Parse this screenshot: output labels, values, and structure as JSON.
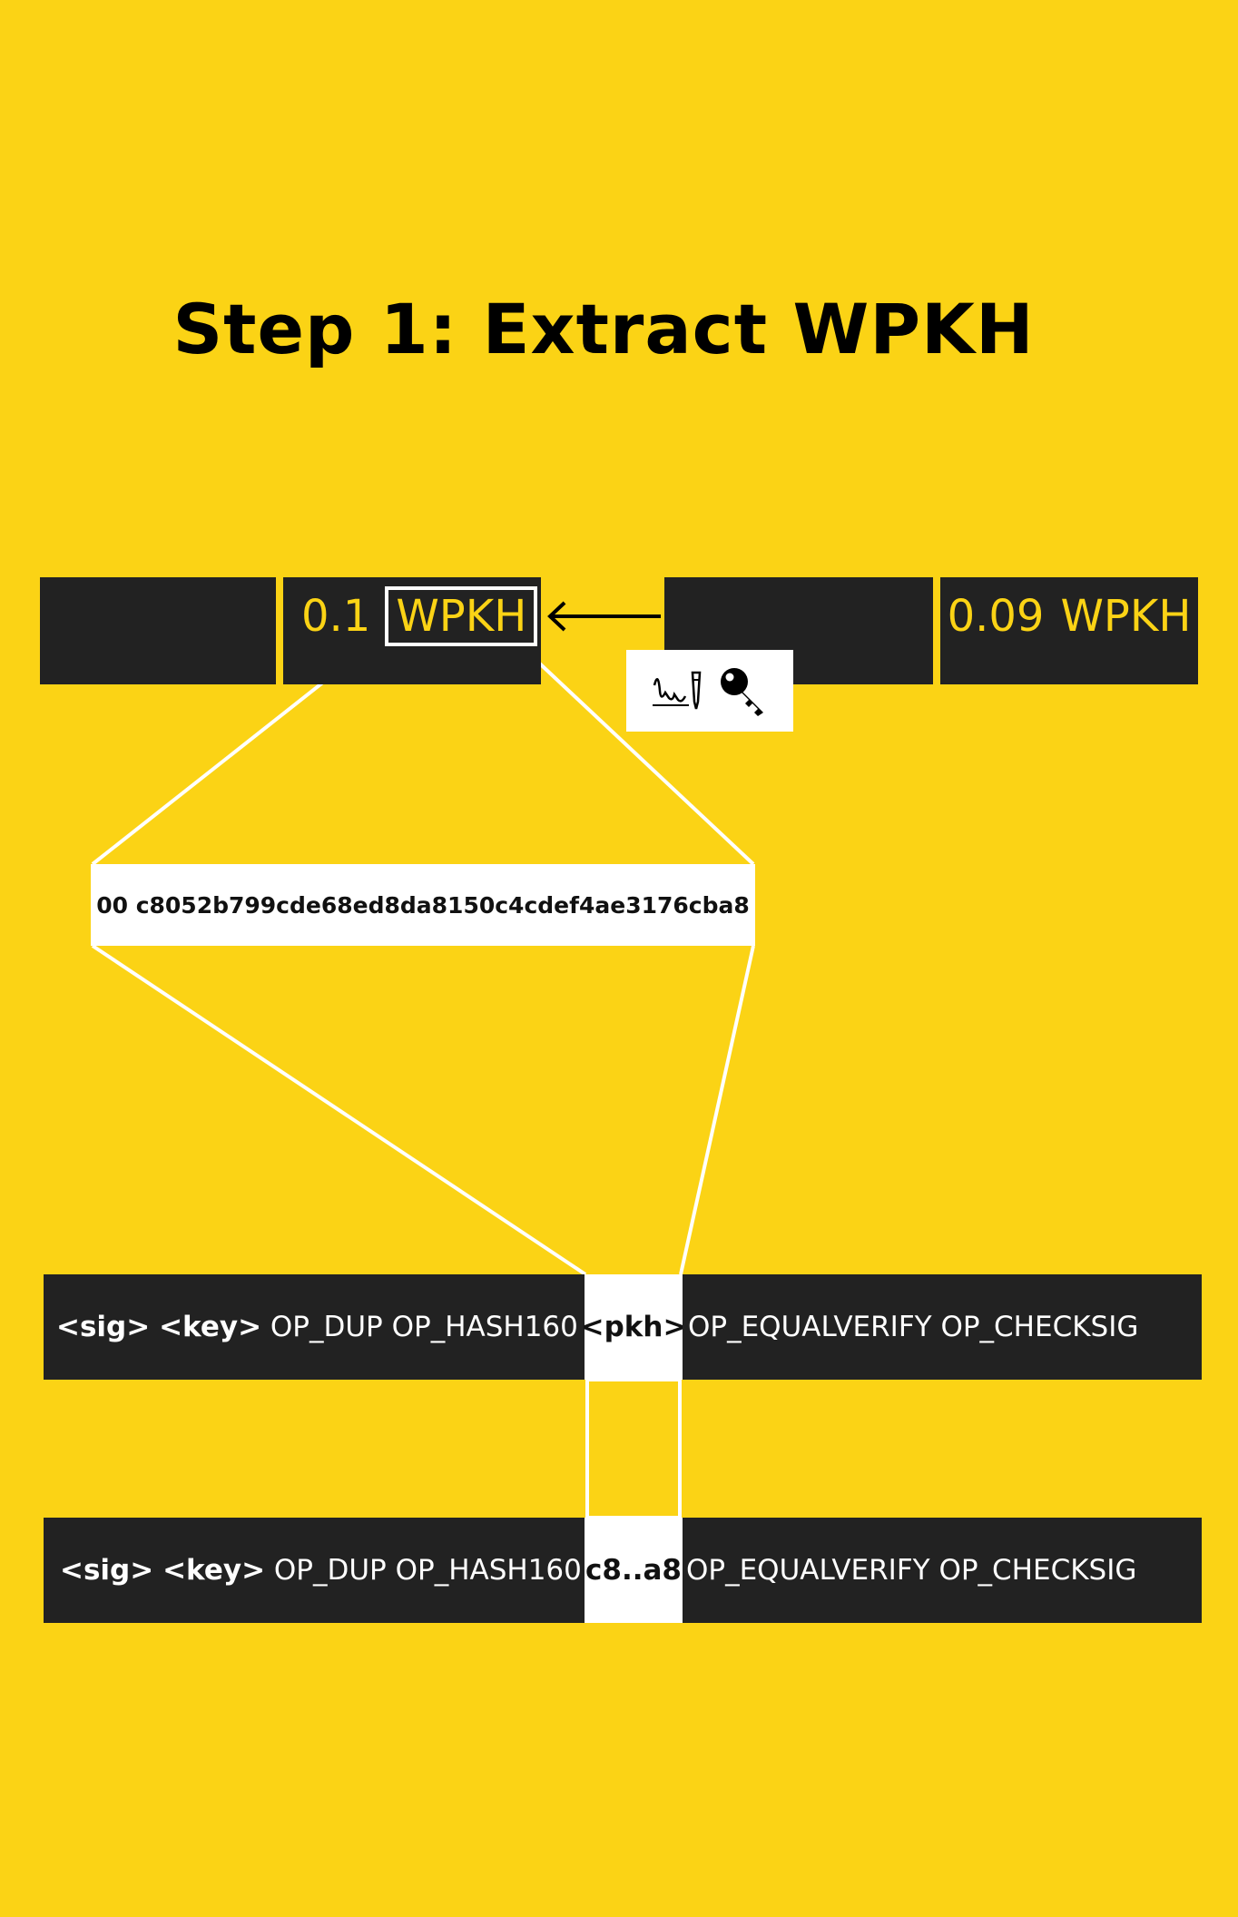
{
  "title": "Step 1: Extract WPKH",
  "tx": {
    "input_amount": "0.1",
    "input_type": "WPKH",
    "output_amount": "0.09",
    "output_type": "WPKH"
  },
  "icons": {
    "signature": "signature-pen-icon",
    "key": "key-icon"
  },
  "hex_value": "00 c8052b799cde68ed8da8150c4cdef4ae3176cba8",
  "script_template": {
    "sig": "<sig>",
    "key": "<key>",
    "ops_before": "OP_DUP OP_HASH160",
    "pkh": "<pkh>",
    "ops_after": "OP_EQUALVERIFY OP_CHECKSIG"
  },
  "script_filled": {
    "sig": "<sig>",
    "key": "<key>",
    "ops_before": "OP_DUP OP_HASH160",
    "pkh": "c8..a8",
    "ops_after": "OP_EQUALVERIFY OP_CHECKSIG"
  },
  "colors": {
    "background": "#FBD315",
    "dark": "#222222",
    "accent": "#FBD315",
    "white": "#FFFFFF"
  }
}
